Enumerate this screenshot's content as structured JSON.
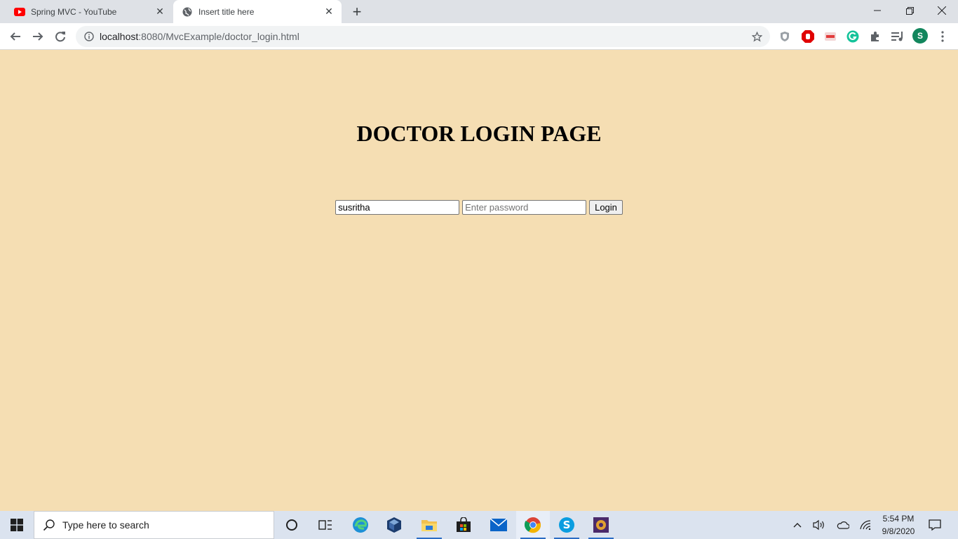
{
  "browser": {
    "tabs": [
      {
        "title": "Spring MVC - YouTube",
        "icon": "youtube-icon"
      },
      {
        "title": "Insert title here",
        "icon": "globe-icon"
      }
    ],
    "url_host": "localhost",
    "url_path": ":8080/MvcExample/doctor_login.html",
    "profile_initial": "S"
  },
  "page": {
    "heading": "DOCTOR LOGIN PAGE",
    "username_value": "susritha",
    "password_placeholder": "Enter password",
    "login_label": "Login"
  },
  "taskbar": {
    "search_placeholder": "Type here to search",
    "time": "5:54 PM",
    "date": "9/8/2020"
  },
  "colors": {
    "page_background": "#f5deb3",
    "tabstrip": "#dee1e6",
    "taskbar": "#dbe3ef"
  }
}
